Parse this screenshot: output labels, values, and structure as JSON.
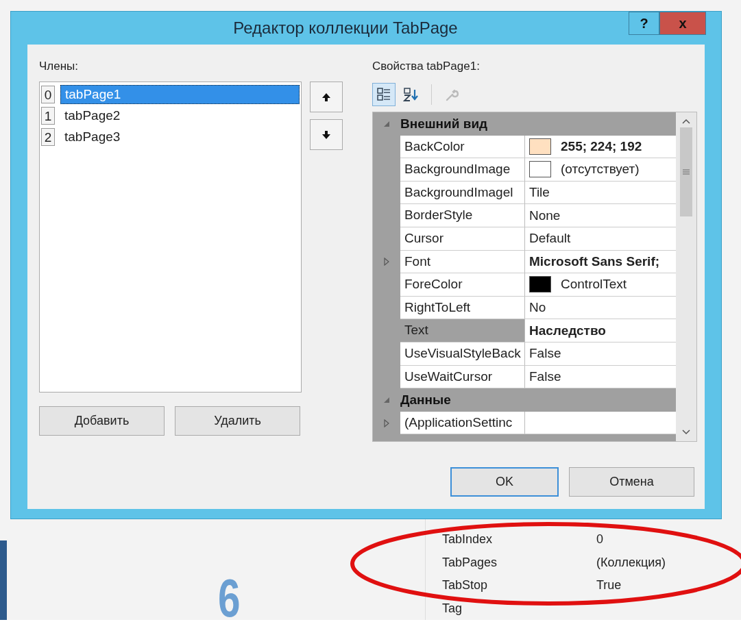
{
  "dialog": {
    "title": "Редактор коллекции TabPage",
    "help_button": "?",
    "close_button": "x"
  },
  "members": {
    "label": "Члены:",
    "items": [
      {
        "index": "0",
        "name": "tabPage1",
        "selected": true
      },
      {
        "index": "1",
        "name": "tabPage2",
        "selected": false
      },
      {
        "index": "2",
        "name": "tabPage3",
        "selected": false
      }
    ]
  },
  "member_buttons": {
    "add": "Добавить",
    "remove": "Удалить"
  },
  "properties": {
    "label": "Свойства tabPage1:",
    "toolbar": [
      {
        "kind": "categorized",
        "selected": true
      },
      {
        "kind": "alphabetical",
        "selected": false
      },
      {
        "kind": "property-pages",
        "selected": false
      }
    ],
    "rows": [
      {
        "kind": "category",
        "name": "Внешний вид",
        "expanded": true
      },
      {
        "kind": "property",
        "name": "BackColor",
        "value": "255; 224; 192",
        "bold": true,
        "color": "#ffe0c0",
        "selected": false
      },
      {
        "kind": "property",
        "name": "BackgroundImage",
        "value": "(отсутствует)",
        "bold": false,
        "color": "#ffffff",
        "selected": false
      },
      {
        "kind": "property",
        "name": "BackgroundImagel",
        "value": "Tile",
        "bold": false,
        "selected": false
      },
      {
        "kind": "property",
        "name": "BorderStyle",
        "value": "None",
        "bold": false,
        "selected": false
      },
      {
        "kind": "property",
        "name": "Cursor",
        "value": "Default",
        "bold": false,
        "selected": false
      },
      {
        "kind": "property",
        "name": "Font",
        "value": "Microsoft Sans Serif;",
        "bold": true,
        "expandable": true,
        "selected": false
      },
      {
        "kind": "property",
        "name": "ForeColor",
        "value": "ControlText",
        "bold": false,
        "color": "#000000",
        "selected": false
      },
      {
        "kind": "property",
        "name": "RightToLeft",
        "value": "No",
        "bold": false,
        "selected": false
      },
      {
        "kind": "property",
        "name": "Text",
        "value": "Наследство",
        "bold": true,
        "selected": true
      },
      {
        "kind": "property",
        "name": "UseVisualStyleBack",
        "value": "False",
        "bold": false,
        "selected": false
      },
      {
        "kind": "property",
        "name": "UseWaitCursor",
        "value": "False",
        "bold": false,
        "selected": false
      },
      {
        "kind": "category",
        "name": "Данные",
        "expanded": true
      },
      {
        "kind": "property",
        "name": "(ApplicationSettinc",
        "expandable": true,
        "selected": false
      }
    ]
  },
  "dialog_buttons": {
    "ok": "OK",
    "cancel": "Отмена"
  },
  "background_grid": {
    "rows": [
      {
        "name": "TabIndex",
        "value": "0"
      },
      {
        "name": "TabPages",
        "value": "(Коллекция)"
      },
      {
        "name": "TabStop",
        "value": "True"
      },
      {
        "name": "Tag"
      }
    ]
  },
  "slide_number": "6"
}
